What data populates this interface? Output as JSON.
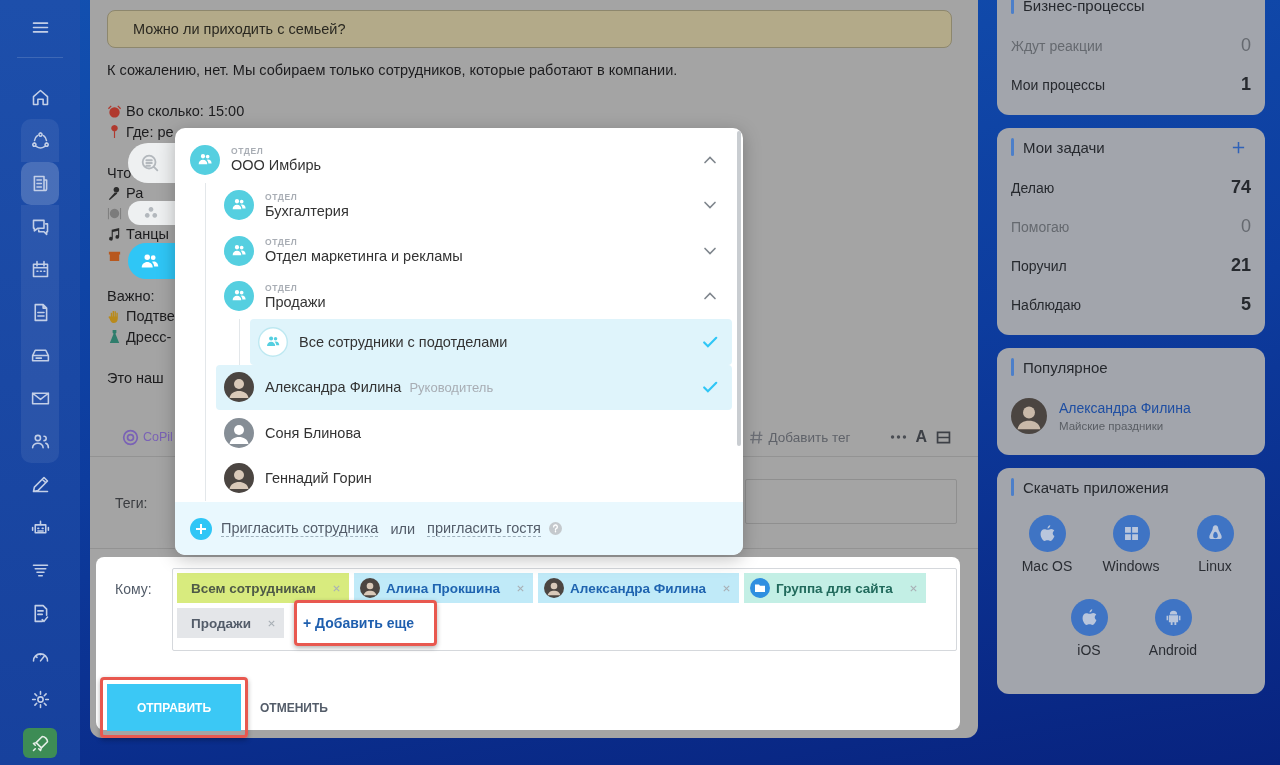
{
  "sidebar": {
    "items": [
      {
        "kind": "menu",
        "selected": false
      },
      {
        "kind": "home",
        "selected": false
      },
      {
        "kind": "flow",
        "selected": false
      },
      {
        "kind": "news",
        "selected": true
      },
      {
        "kind": "chat",
        "selected": false
      },
      {
        "kind": "calendar",
        "selected": false
      },
      {
        "kind": "doc",
        "selected": false
      },
      {
        "kind": "drive",
        "selected": false
      },
      {
        "kind": "mail",
        "selected": false
      },
      {
        "kind": "people",
        "selected": false
      },
      {
        "kind": "pen",
        "selected": false
      },
      {
        "kind": "robot",
        "selected": false
      },
      {
        "kind": "filter",
        "selected": false
      },
      {
        "kind": "sign",
        "selected": false
      },
      {
        "kind": "speed",
        "selected": false
      },
      {
        "kind": "gear",
        "selected": false
      },
      {
        "kind": "rocket",
        "selected": false
      }
    ]
  },
  "post": {
    "question": "Можно ли приходить с семьей?",
    "paragraphs": [
      [
        {
          "text": "К сожалению, нет. Мы собираем только сотрудников, которые работают в компании."
        }
      ],
      [
        {
          "kind": "alarm",
          "text": "Во сколько: 15:00"
        },
        {
          "kind": "pin",
          "text": "Где: ре"
        }
      ],
      [
        {
          "text": "Что"
        },
        {
          "kind": "microphone",
          "text": "Ра"
        },
        {
          "kind": "plate"
        },
        {
          "kind": "note",
          "text": "Танцы"
        },
        {
          "kind": "gift"
        }
      ],
      [
        {
          "text": "Важно:"
        },
        {
          "kind": "hand",
          "text": "Подтве"
        },
        {
          "kind": "dress",
          "text": "Дресс-"
        }
      ],
      [
        {
          "text": "Это наш"
        }
      ]
    ]
  },
  "toolbar": {
    "copilot": "CoPil",
    "add_tag": "Добавить тег",
    "format": "A"
  },
  "tags": {
    "label": "Теги:"
  },
  "selector": {
    "tabs": [
      {
        "kind": "search",
        "selected": false
      },
      {
        "kind": "structure",
        "selected": false
      },
      {
        "kind": "departments",
        "selected": true
      }
    ],
    "tree": [
      {
        "kind": "department",
        "caption": "ОТДЕЛ",
        "name": "ООО Имбирь",
        "expanded": true,
        "selected": false,
        "children": [
          {
            "kind": "department",
            "caption": "ОТДЕЛ",
            "name": "Бухгалтерия",
            "expanded": false,
            "selected": false
          },
          {
            "kind": "department",
            "caption": "ОТДЕЛ",
            "name": "Отдел маркетинга и рекламы",
            "expanded": false,
            "selected": false
          },
          {
            "kind": "department",
            "caption": "ОТДЕЛ",
            "name": "Продажи",
            "expanded": true,
            "selected": false,
            "children": [
              {
                "kind": "all",
                "name": "Все сотрудники с подотделами",
                "selected": true
              }
            ]
          },
          {
            "kind": "user",
            "name": "Александра Филина",
            "role": "Руководитель",
            "photo": true,
            "selected": true
          },
          {
            "kind": "user",
            "name": "Соня Блинова",
            "photo": false,
            "selected": false
          },
          {
            "kind": "user",
            "name": "Геннадий Горин",
            "photo": true,
            "selected": false
          }
        ]
      }
    ],
    "footer": {
      "invite_employee": "Пригласить сотрудника",
      "or": "или",
      "invite_guest": "пригласить гостя"
    }
  },
  "compose": {
    "to_label": "Кому:",
    "recipients": [
      {
        "kind": "everyone",
        "name": "Всем сотрудникам"
      },
      {
        "kind": "user",
        "name": "Алина Прокшина"
      },
      {
        "kind": "user",
        "name": "Александра Филина"
      },
      {
        "kind": "group",
        "name": "Группа для сайта"
      },
      {
        "kind": "department",
        "name": "Продажи"
      }
    ],
    "add_more": {
      "label": "+ Добавить еще",
      "highlighted": true
    },
    "send": {
      "label": "ОТПРАВИТЬ",
      "highlighted": true
    },
    "cancel": "ОТМЕНИТЬ"
  },
  "widgets": [
    {
      "kind": "counters",
      "title": "Бизнес-процессы",
      "add": false,
      "counters": [
        {
          "label": "Ждут реакции",
          "value": "0",
          "muted": true
        },
        {
          "label": "Мои процессы",
          "value": "1",
          "muted": false
        }
      ]
    },
    {
      "kind": "counters",
      "title": "Мои задачи",
      "add": true,
      "counters": [
        {
          "label": "Делаю",
          "value": "74",
          "muted": false
        },
        {
          "label": "Помогаю",
          "value": "0",
          "muted": true
        },
        {
          "label": "Поручил",
          "value": "21",
          "muted": false
        },
        {
          "label": "Наблюдаю",
          "value": "5",
          "muted": false
        }
      ]
    },
    {
      "kind": "popular",
      "title": "Популярное",
      "items": [
        {
          "name": "Александра Филина",
          "subtitle": "Майские праздники"
        }
      ]
    },
    {
      "kind": "apps",
      "title": "Скачать приложения",
      "apps": [
        {
          "kind": "apple",
          "label": "Mac OS"
        },
        {
          "kind": "windows",
          "label": "Windows"
        },
        {
          "kind": "linux",
          "label": "Linux"
        },
        {
          "kind": "apple",
          "label": "iOS"
        },
        {
          "kind": "android",
          "label": "Android"
        }
      ]
    }
  ]
}
